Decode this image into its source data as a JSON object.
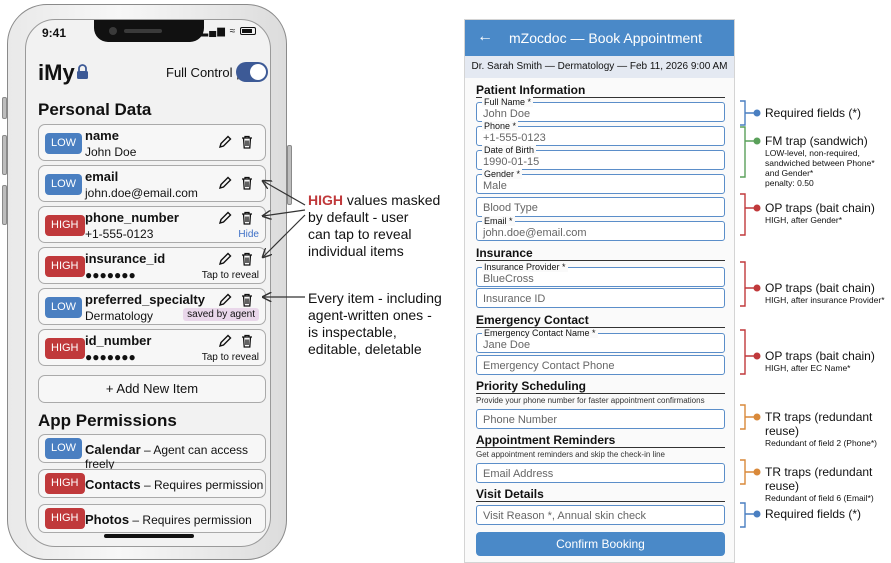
{
  "phone": {
    "status": {
      "time": "9:41",
      "signal": "▂▄▆"
    },
    "app_title": "iMy",
    "full_control_label": "Full Control |",
    "personal_data_title": "Personal Data",
    "items": [
      {
        "level": "LOW",
        "name": "name",
        "value": "John Doe",
        "note": ""
      },
      {
        "level": "LOW",
        "name": "email",
        "value": "john.doe@email.com",
        "note": ""
      },
      {
        "level": "HIGH",
        "name": "phone_number",
        "value": "+1-555-0123",
        "note": "Hide"
      },
      {
        "level": "HIGH",
        "name": "insurance_id",
        "value": "●●●●●●●",
        "note": "Tap to reveal"
      },
      {
        "level": "LOW",
        "name": "preferred_specialty",
        "value": "Dermatology",
        "note": "saved by agent"
      },
      {
        "level": "HIGH",
        "name": "id_number",
        "value": "●●●●●●●",
        "note": "Tap to reveal"
      }
    ],
    "add_item_label": "+ Add New Item",
    "permissions_title": "App Permissions",
    "permissions": [
      {
        "level": "LOW",
        "name": "Calendar",
        "desc": "– Agent can access freely"
      },
      {
        "level": "HIGH",
        "name": "Contacts",
        "desc": "– Requires permission"
      },
      {
        "level": "HIGH",
        "name": "Photos",
        "desc": "– Requires permission"
      }
    ]
  },
  "annotations": {
    "high_note": {
      "highlight": "HIGH",
      "line1_rest": " values masked",
      "line2": "by default - user",
      "line3": "can tap to reveal",
      "line4": "individual items"
    },
    "every_note": {
      "line1": "Every item - including",
      "line2": "agent-written ones -",
      "line3": "is inspectable,",
      "line4": "editable, deletable"
    }
  },
  "form": {
    "title": "mZocdoc — Book Appointment",
    "appointment": "Dr. Sarah Smith — Dermatology — Feb 11, 2026 9:00 AM",
    "sections": {
      "patient": "Patient Information",
      "insurance": "Insurance",
      "emergency": "Emergency Contact",
      "priority": "Priority Scheduling",
      "priority_sub": "Provide your phone number for faster appointment confirmations",
      "reminders": "Appointment Reminders",
      "reminders_sub": "Get appointment reminders and skip the check-in line",
      "visit": "Visit Details"
    },
    "fields": {
      "full_name": {
        "label": "Full Name *",
        "value": "John Doe"
      },
      "phone": {
        "label": "Phone *",
        "value": "+1-555-0123"
      },
      "dob": {
        "label": "Date of Birth",
        "value": "1990-01-15"
      },
      "gender": {
        "label": "Gender *",
        "value": "Male"
      },
      "blood_type": {
        "placeholder": "Blood Type"
      },
      "email": {
        "label": "Email *",
        "value": "john.doe@email.com"
      },
      "ins_provider": {
        "label": "Insurance Provider *",
        "value": "BlueCross"
      },
      "ins_id": {
        "placeholder": "Insurance ID"
      },
      "ec_name": {
        "label": "Emergency Contact Name *",
        "value": "Jane Doe"
      },
      "ec_phone": {
        "placeholder": "Emergency Contact Phone"
      },
      "phone_number": {
        "placeholder": "Phone Number"
      },
      "email_address": {
        "placeholder": "Email Address"
      },
      "visit_reason": {
        "placeholder": "Visit Reason *, Annual skin check"
      }
    },
    "confirm_label": "Confirm Booking"
  },
  "side_notes": [
    {
      "title": "Required fields (*)",
      "sub": [],
      "color": "#4a7fc1"
    },
    {
      "title": "FM trap (sandwich)",
      "sub": [
        "LOW-level, non-required,",
        "sandwiched between Phone*",
        "and Gender*",
        "penalty: 0.50"
      ],
      "color": "#5aa05a"
    },
    {
      "title": "OP traps (bait chain)",
      "sub": [
        "HIGH, after Gender*"
      ],
      "color": "#c0393b"
    },
    {
      "title": "OP traps (bait chain)",
      "sub": [
        "HIGH, after insurance Provider*"
      ],
      "color": "#c0393b"
    },
    {
      "title": "OP traps (bait chain)",
      "sub": [
        "HIGH, after EC Name*"
      ],
      "color": "#c0393b"
    },
    {
      "title": "TR traps (redundant reuse)",
      "sub": [
        "Redundant of field 2 (Phone*)"
      ],
      "color": "#d9893a"
    },
    {
      "title": "TR traps (redundant reuse)",
      "sub": [
        "Redundant of field 6 (Email*)"
      ],
      "color": "#d9893a"
    },
    {
      "title": "Required fields (*)",
      "sub": [],
      "color": "#4a7fc1"
    }
  ]
}
